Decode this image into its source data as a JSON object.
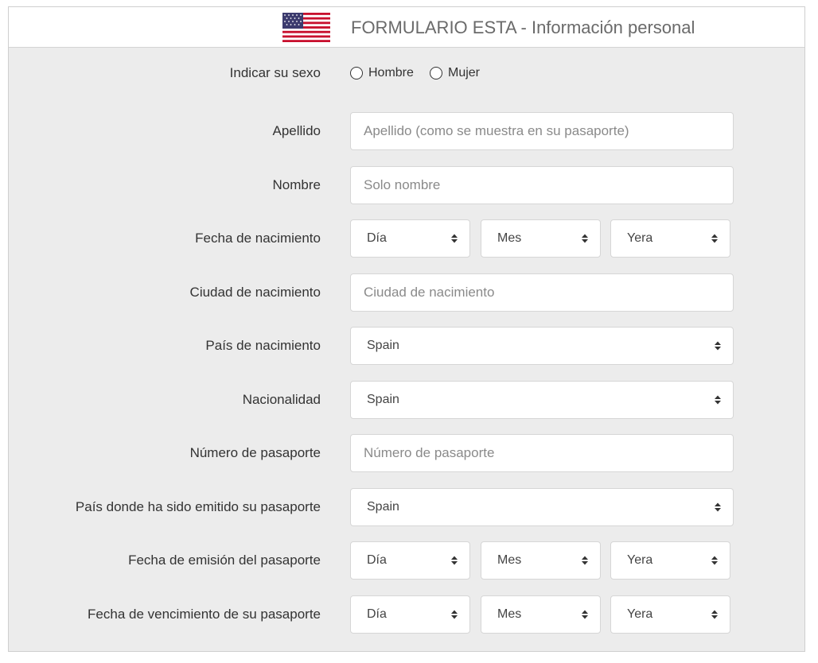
{
  "header": {
    "title": "FORMULARIO ESTA - Información personal",
    "flag_icon": "us-flag-icon"
  },
  "colors": {
    "panel_bg": "#ececec",
    "header_bg": "#ffffff",
    "title_color": "#6a6a6a",
    "input_border": "#d6d6d6"
  },
  "form": {
    "sex": {
      "label": "Indicar su sexo",
      "options": [
        "Hombre",
        "Mujer"
      ],
      "selected": null
    },
    "surname": {
      "label": "Apellido",
      "placeholder": "Apellido (como se muestra en su pasaporte)",
      "value": ""
    },
    "first_name": {
      "label": "Nombre",
      "placeholder": "Solo nombre",
      "value": ""
    },
    "birth_date": {
      "label": "Fecha de nacimiento",
      "day": "Día",
      "month": "Mes",
      "year": "Yera"
    },
    "birth_city": {
      "label": "Ciudad de nacimiento",
      "placeholder": "Ciudad de nacimiento",
      "value": ""
    },
    "birth_country": {
      "label": "País de nacimiento",
      "value": "Spain"
    },
    "nationality": {
      "label": "Nacionalidad",
      "value": "Spain"
    },
    "passport_number": {
      "label": "Número de pasaporte",
      "placeholder": "Número de pasaporte",
      "value": ""
    },
    "passport_country": {
      "label": "País donde ha sido emitido su pasaporte",
      "value": "Spain"
    },
    "passport_issue_date": {
      "label": "Fecha de emisión del pasaporte",
      "day": "Día",
      "month": "Mes",
      "year": "Yera"
    },
    "passport_expiry_date": {
      "label": "Fecha de vencimiento de su pasaporte",
      "day": "Día",
      "month": "Mes",
      "year": "Yera"
    }
  }
}
